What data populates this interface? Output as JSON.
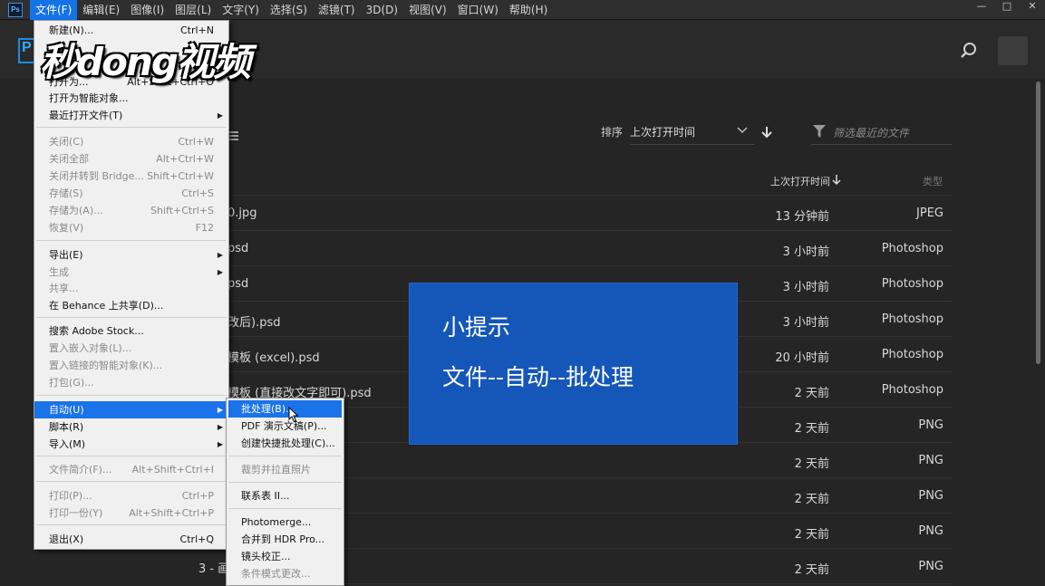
{
  "menubar": {
    "app_icon": "photoshop-icon",
    "app_icon_text": "Ps",
    "items": [
      "文件(F)",
      "编辑(E)",
      "图像(I)",
      "图层(L)",
      "文字(Y)",
      "选择(S)",
      "滤镜(T)",
      "3D(D)",
      "视图(V)",
      "窗口(W)",
      "帮助(H)"
    ],
    "window_controls": [
      "—",
      "□",
      "✕"
    ]
  },
  "header": {
    "home_logo_text": "P",
    "watermark": "秒dong视频",
    "search_icon": "search-icon"
  },
  "toolbar": {
    "sort_label": "排序",
    "sort_value": "上次打开时间",
    "filter_placeholder": "筛选最近的文件"
  },
  "table": {
    "col_last_opened": "上次打开时间",
    "col_type": "类型",
    "rows": [
      {
        "name": "0.jpg",
        "time": "13 分钟前",
        "type": "JPEG"
      },
      {
        "name": "psd",
        "time": "3 小时前",
        "type": "Photoshop"
      },
      {
        "name": "psd",
        "time": "3 小时前",
        "type": "Photoshop"
      },
      {
        "name": "改后).psd",
        "time": "3 小时前",
        "type": "Photoshop"
      },
      {
        "name": "模板 (excel).psd",
        "time": "20 小时前",
        "type": "Photoshop"
      },
      {
        "name": "模板 (直接改文字即可).psd",
        "time": "2 天前",
        "type": "Photoshop"
      },
      {
        "name": "",
        "time": "2 天前",
        "type": "PNG"
      },
      {
        "name": "",
        "time": "2 天前",
        "type": "PNG"
      },
      {
        "name": "",
        "time": "2 天前",
        "type": "PNG"
      },
      {
        "name": "",
        "time": "2 天前",
        "type": "PNG"
      },
      {
        "name": "",
        "time": "2 天前",
        "type": "PNG"
      }
    ],
    "last_row_name": "3 - 画"
  },
  "tip": {
    "title": "小提示",
    "body": "文件--自动--批处理"
  },
  "file_menu": {
    "items": [
      {
        "label": "新建(N)...",
        "shortcut": "Ctrl+N",
        "disabled": false
      },
      {
        "label": "打开为...",
        "shortcut": "Alt+Shift+Ctrl+O",
        "disabled": false
      },
      {
        "label": "打开为智能对象...",
        "shortcut": "",
        "disabled": false
      },
      {
        "label": "最近打开文件(T)",
        "shortcut": "",
        "disabled": false,
        "submenu": true
      },
      {
        "label": "关闭(C)",
        "shortcut": "Ctrl+W",
        "disabled": true
      },
      {
        "label": "关闭全部",
        "shortcut": "Alt+Ctrl+W",
        "disabled": true
      },
      {
        "label": "关闭并转到 Bridge...",
        "shortcut": "Shift+Ctrl+W",
        "disabled": true
      },
      {
        "label": "存储(S)",
        "shortcut": "Ctrl+S",
        "disabled": true
      },
      {
        "label": "存储为(A)...",
        "shortcut": "Shift+Ctrl+S",
        "disabled": true
      },
      {
        "label": "恢复(V)",
        "shortcut": "F12",
        "disabled": true
      },
      {
        "label": "导出(E)",
        "shortcut": "",
        "disabled": false,
        "submenu": true
      },
      {
        "label": "生成",
        "shortcut": "",
        "disabled": true,
        "submenu": true
      },
      {
        "label": "共享...",
        "shortcut": "",
        "disabled": true
      },
      {
        "label": "在 Behance 上共享(D)...",
        "shortcut": "",
        "disabled": false
      },
      {
        "label": "搜索 Adobe Stock...",
        "shortcut": "",
        "disabled": false
      },
      {
        "label": "置入嵌入对象(L)...",
        "shortcut": "",
        "disabled": true
      },
      {
        "label": "置入链接的智能对象(K)...",
        "shortcut": "",
        "disabled": true
      },
      {
        "label": "打包(G)...",
        "shortcut": "",
        "disabled": true
      },
      {
        "label": "自动(U)",
        "shortcut": "",
        "disabled": false,
        "submenu": true,
        "highlighted": true
      },
      {
        "label": "脚本(R)",
        "shortcut": "",
        "disabled": false,
        "submenu": true
      },
      {
        "label": "导入(M)",
        "shortcut": "",
        "disabled": false,
        "submenu": true
      },
      {
        "label": "文件简介(F)...",
        "shortcut": "Alt+Shift+Ctrl+I",
        "disabled": true
      },
      {
        "label": "打印(P)...",
        "shortcut": "Ctrl+P",
        "disabled": true
      },
      {
        "label": "打印一份(Y)",
        "shortcut": "Alt+Shift+Ctrl+P",
        "disabled": true
      },
      {
        "label": "退出(X)",
        "shortcut": "Ctrl+Q",
        "disabled": false
      }
    ]
  },
  "automate_menu": {
    "items": [
      {
        "label": "批处理(B)...",
        "disabled": false,
        "highlighted": true
      },
      {
        "label": "PDF 演示文稿(P)...",
        "disabled": false
      },
      {
        "label": "创建快捷批处理(C)...",
        "disabled": false
      },
      {
        "label": "裁剪并拉直照片",
        "disabled": true
      },
      {
        "label": "联系表 II...",
        "disabled": false
      },
      {
        "label": "Photomerge...",
        "disabled": false
      },
      {
        "label": "合并到 HDR Pro...",
        "disabled": false
      },
      {
        "label": "镜头校正...",
        "disabled": false
      },
      {
        "label": "条件模式更改...",
        "disabled": true
      }
    ]
  },
  "colors": {
    "menu_highlight": "#1a73e8",
    "tip_background": "#1557b8",
    "app_background": "#252525"
  }
}
